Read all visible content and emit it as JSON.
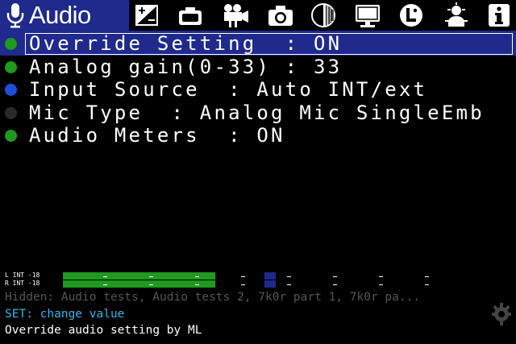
{
  "tabs": {
    "active_title": "Audio",
    "icons": [
      "microphone-icon",
      "exposure-icon",
      "camera-body-icon",
      "movie-camera-icon",
      "photo-camera-icon",
      "focus-icon",
      "display-icon",
      "scripts-icon",
      "debug-icon",
      "info-icon"
    ]
  },
  "menu": {
    "items": [
      {
        "label": "Override Setting  : ON",
        "status": "green",
        "selected": true
      },
      {
        "label": "Analog gain(0-33) : 33",
        "status": "green",
        "selected": false
      },
      {
        "label": "Input Source  : Auto INT/ext",
        "status": "blue",
        "selected": false
      },
      {
        "label": "Mic Type  : Analog Mic SingleEmb",
        "status": "dark",
        "selected": false
      },
      {
        "label": "Audio Meters  : ON",
        "status": "green",
        "selected": false
      }
    ]
  },
  "meters": {
    "left_label": "L INT -18",
    "right_label": "R INT -18",
    "level_fraction": 0.34,
    "peak_fraction": 0.45
  },
  "footer": {
    "hidden": "Hidden: Audio tests, Audio tests 2, 7k0r part 1, 7k0r pa...",
    "set_hint": "SET: change value",
    "help": "Override audio setting by ML"
  },
  "colors": {
    "accent": "#1f2a8c",
    "green": "#1e9a1e",
    "blue": "#1a4fd8",
    "dark": "#2a2a2a",
    "hint": "#38b4e8"
  }
}
